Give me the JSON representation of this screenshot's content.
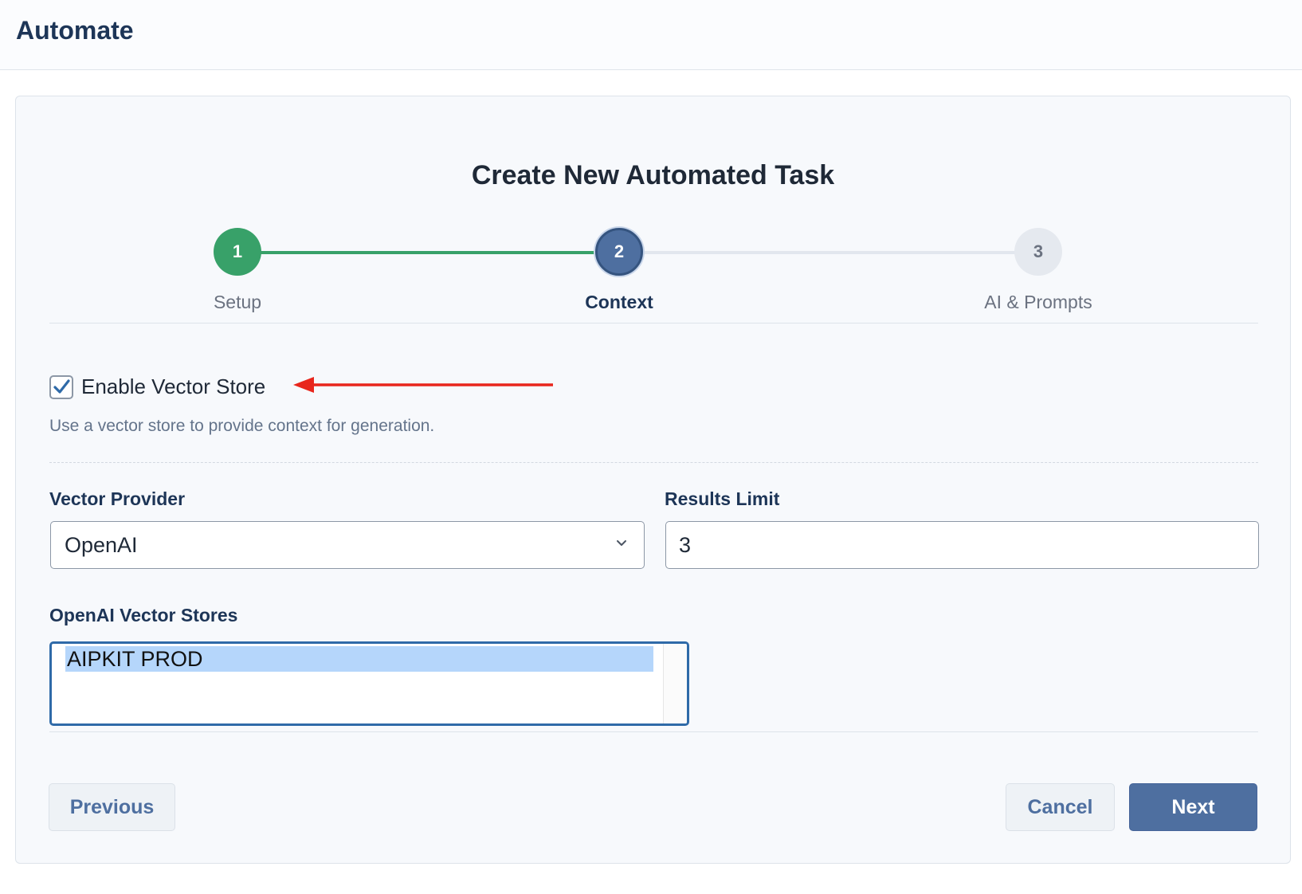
{
  "header": {
    "title": "Automate"
  },
  "wizard": {
    "title": "Create New Automated Task",
    "steps": [
      {
        "number": "1",
        "label": "Setup",
        "state": "complete"
      },
      {
        "number": "2",
        "label": "Context",
        "state": "active"
      },
      {
        "number": "3",
        "label": "AI & Prompts",
        "state": "pending"
      }
    ]
  },
  "context": {
    "enable_vector_store": {
      "label": "Enable Vector Store",
      "checked": true
    },
    "helper_text": "Use a vector store to provide context for generation.",
    "vector_provider": {
      "label": "Vector Provider",
      "value": "OpenAI"
    },
    "results_limit": {
      "label": "Results Limit",
      "value": "3"
    },
    "vector_stores": {
      "label": "OpenAI Vector Stores",
      "options": [
        "AIPKIT PROD"
      ],
      "selected": "AIPKIT PROD"
    }
  },
  "footer": {
    "previous_label": "Previous",
    "cancel_label": "Cancel",
    "next_label": "Next"
  },
  "colors": {
    "complete": "#38a169",
    "active": "#4e6fa0",
    "pending": "#e5e9ef",
    "primary_button": "#4e6fa0",
    "annotation_arrow": "#e8261c"
  },
  "icons": {
    "checkbox": "checkmark-icon",
    "select": "chevron-down-icon",
    "annotation": "red-arrow-left-icon"
  }
}
